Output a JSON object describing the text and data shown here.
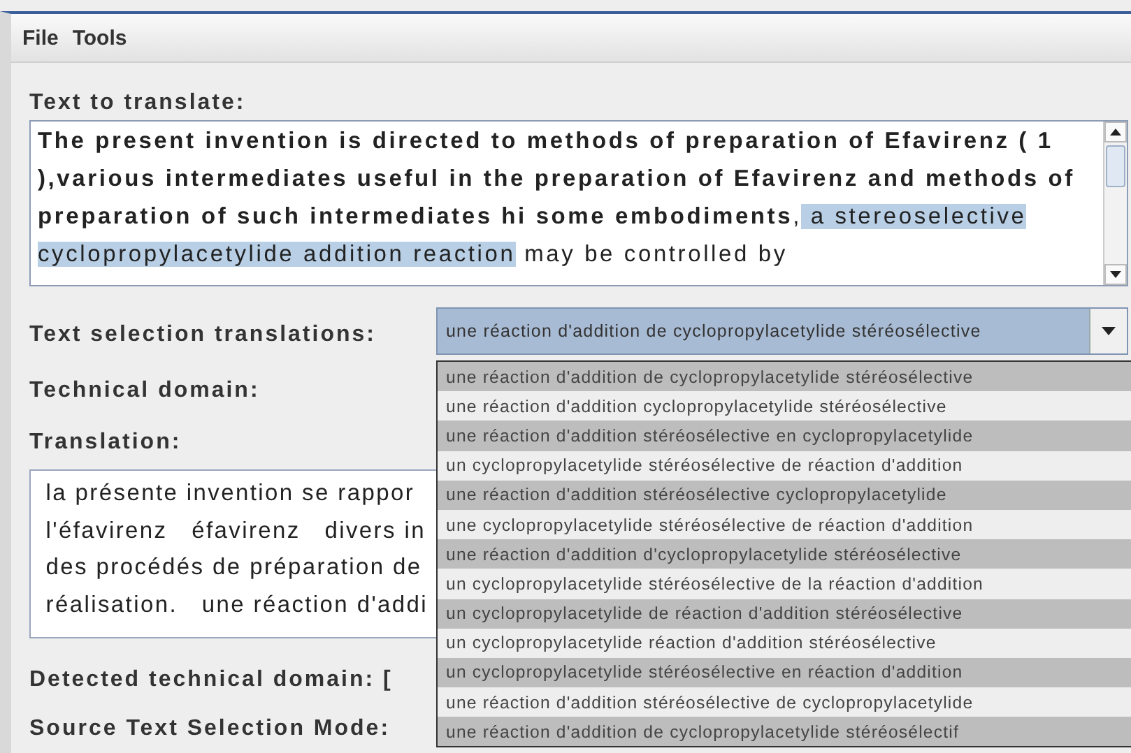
{
  "menu": [
    {
      "label": "File"
    },
    {
      "label": "Tools"
    }
  ],
  "source": {
    "label": "Text to translate:",
    "segments": [
      {
        "text": "The present invention is directed to methods of preparation of Efavirenz ( 1 ),various intermediates useful in the preparation of Efavirenz and methods of preparation of such intermediates hi some embodiments",
        "bold": true,
        "selected": false
      },
      {
        "text": ",",
        "bold": false,
        "selected": false
      },
      {
        "text": " a stereoselective cyclopropylacetylide addition reaction",
        "bold": false,
        "selected": true
      },
      {
        "text": " may be controlled by",
        "bold": false,
        "selected": false
      }
    ]
  },
  "selection": {
    "label": "Text selection translations:",
    "value": "une réaction d'addition de cyclopropylacetylide stéréosélective",
    "options": [
      "une réaction d'addition de cyclopropylacetylide stéréosélective",
      "une réaction d'addition cyclopropylacetylide stéréosélective",
      "une réaction d'addition stéréosélective en cyclopropylacetylide",
      "un cyclopropylacetylide stéréosélective de réaction d'addition",
      "une réaction d'addition stéréosélective cyclopropylacetylide",
      "une cyclopropylacetylide stéréosélective de réaction d'addition",
      "une réaction d'addition d'cyclopropylacetylide stéréosélective",
      "un cyclopropylacetylide stéréosélective de la réaction d'addition",
      "un cyclopropylacetylide de réaction d'addition stéréosélective",
      "un cyclopropylacetylide réaction d'addition stéréosélective",
      "un cyclopropylacetylide stéréosélective en réaction d'addition",
      "une réaction d'addition stéréosélective de cyclopropylacetylide",
      "une réaction d'addition de cyclopropylacetylide stéréosélectif"
    ]
  },
  "domain": {
    "label": "Technical domain:"
  },
  "translation": {
    "label": "Translation:",
    "lines": [
      "la présente invention se rappor",
      "l'éfavirenz   éfavirenz   divers in",
      "des procédés de préparation de",
      "réalisation.   une réaction d'addi"
    ]
  },
  "detected": "Detected technical domain: [",
  "mode": "Source Text Selection Mode:"
}
